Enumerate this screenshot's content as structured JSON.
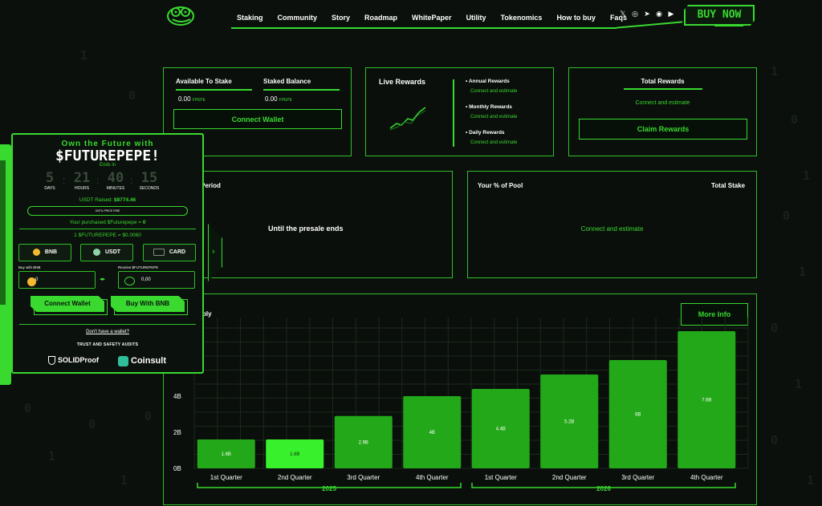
{
  "nav": {
    "links": [
      "Staking",
      "Community",
      "Story",
      "Roadmap",
      "WhitePaper",
      "Utility",
      "Tokenomics",
      "How to buy",
      "Faqs"
    ],
    "buy_now": "BUY NOW"
  },
  "staking": {
    "available_label": "Available To Stake",
    "available_value": "0.00",
    "available_unit": "FPEPE",
    "staked_label": "Staked Balance",
    "staked_value": "0.00",
    "staked_unit": "FPEPE",
    "connect_wallet": "Connect Wallet"
  },
  "live_rewards": {
    "title": "Live Rewards",
    "annual_label": "Annual Rewards",
    "annual_sub": "Connect and estimate",
    "monthly_label": "Monthly Rewards",
    "monthly_sub": "Connect and estimate",
    "daily_label": "Daily Rewards",
    "daily_sub": "Connect and estimate"
  },
  "total_rewards": {
    "title": "Total Rewards",
    "sub": "Connect and estimate",
    "claim": "Claim Rewards"
  },
  "period": {
    "title": "Period",
    "text": "Until the presale ends"
  },
  "pool": {
    "pct_label": "Your % of Pool",
    "total_label": "Total Stake",
    "text": "Connect and estimate"
  },
  "supply": {
    "title": "ply",
    "more_info": "More Info"
  },
  "chart_data": {
    "type": "bar",
    "categories": [
      "1st Quarter",
      "2nd Quarter",
      "3rd Quarter",
      "4th Quarter",
      "1st Quarter",
      "2nd Quarter",
      "3rd Quarter",
      "4th Quarter"
    ],
    "values": [
      1.6,
      1.6,
      2.9,
      4,
      4.4,
      5.2,
      6,
      7.6
    ],
    "value_labels": [
      "1.6B",
      "1.6B",
      "2.9B",
      "4B",
      "4.4B",
      "5.2B",
      "6B",
      "7.6B"
    ],
    "y_ticks": [
      "0B",
      "2B",
      "4B"
    ],
    "groups": [
      "2025",
      "2026"
    ],
    "highlight_index": 1,
    "bar_color": "#22a818",
    "highlight_color": "#39f02c"
  },
  "presale": {
    "title": "Own the Future with",
    "brand": "$FUTUREPEPE!",
    "ends_in": "Ends in",
    "days": "5",
    "days_label": "DAYS",
    "hours": "21",
    "hours_label": "HOURS",
    "minutes": "40",
    "minutes_label": "MINUTES",
    "seconds": "15",
    "seconds_label": "SECONDS",
    "raised_label": "USDT Raised:",
    "raised_value": "$8774.46",
    "progress_text": "UNTIL PRICE RISE",
    "purchased_label": "Your purchased $Futurepepe =",
    "purchased_value": "0",
    "rate": "1 $FUTUREPEPE = $0.0060",
    "tokens": [
      "BNB",
      "USDT",
      "CARD"
    ],
    "pay_label": "Buy with BNB",
    "pay_value": "0",
    "receive_label": "Receive $FUTUREPEPE",
    "receive_value": "0,00",
    "connect_wallet": "Connect Wallet",
    "buy_with_bnb": "Buy With BNB",
    "no_wallet": "Don't have a wallet?",
    "audits": "TRUST AND SAFETY AUDITS",
    "audit1": "SOLIDProof",
    "audit2": "Coinsult"
  }
}
